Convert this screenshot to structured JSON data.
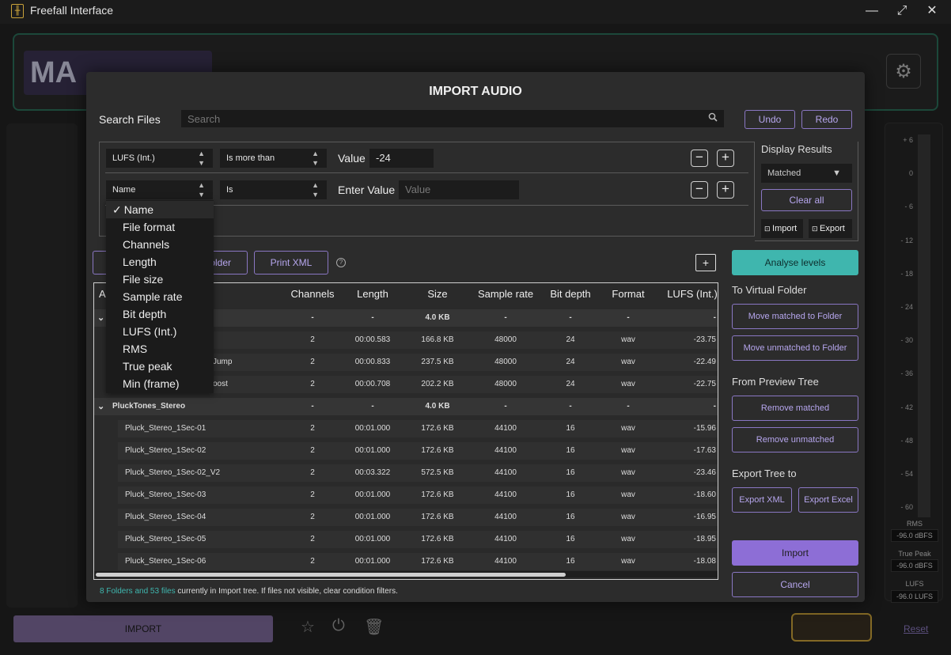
{
  "window": {
    "title": "Freefall Interface",
    "min": "—",
    "max": "⤢",
    "close": "✕"
  },
  "background": {
    "logo_text": "MA",
    "import_label": "IMPORT",
    "reset_label": "Reset",
    "meter": {
      "ticks": [
        "+ 6",
        "0",
        "- 6",
        "- 12",
        "- 18",
        "- 24",
        "- 30",
        "- 36",
        "- 42",
        "- 48",
        "- 54",
        "- 60"
      ],
      "rms_label": "RMS",
      "rms_value": "-96.0 dBFS",
      "peak_label": "True Peak",
      "peak_value": "-96.0 dBFS",
      "lufs_label": "LUFS",
      "lufs_value": "-96.0 LUFS"
    }
  },
  "modal": {
    "title": "IMPORT AUDIO",
    "search_label": "Search Files",
    "search_placeholder": "Search",
    "undo": "Undo",
    "redo": "Redo",
    "filters": [
      {
        "field": "LUFS (Int.)",
        "operator": "Is more than",
        "value_label": "Value",
        "value": "-24"
      },
      {
        "field": "Name",
        "operator": "Is",
        "value_label": "Enter Value",
        "value_placeholder": "Value"
      }
    ],
    "display_results": {
      "label": "Display Results",
      "selected": "Matched",
      "clear_all": "Clear all",
      "import": "Import",
      "export": "Export"
    },
    "toolbar": {
      "folder_btn": "older",
      "print_xml": "Print XML"
    },
    "dropdown": {
      "items": [
        "Name",
        "File format",
        "Channels",
        "Length",
        "File size",
        "Sample rate",
        "Bit depth",
        "LUFS (Int.)",
        "RMS",
        "True peak",
        "Min (frame)"
      ],
      "selected_mark": "✓"
    },
    "table": {
      "headers": {
        "name": "A",
        "channels": "Channels",
        "length": "Length",
        "size": "Size",
        "sample_rate": "Sample rate",
        "bit_depth": "Bit depth",
        "format": "Format",
        "lufs": "LUFS (Int.)"
      },
      "rows": [
        {
          "type": "folder",
          "name": "",
          "channels": "-",
          "length": "-",
          "size": "4.0 KB",
          "sample_rate": "-",
          "bit_depth": "-",
          "format": "-",
          "lufs": "-"
        },
        {
          "type": "file",
          "name": "",
          "channels": "2",
          "length": "00:00.583",
          "size": "166.8 KB",
          "sample_rate": "48000",
          "bit_depth": "24",
          "format": "wav",
          "lufs": "-23.75"
        },
        {
          "type": "file",
          "name": "Jump",
          "channels": "2",
          "length": "00:00.833",
          "size": "237.5 KB",
          "sample_rate": "48000",
          "bit_depth": "24",
          "format": "wav",
          "lufs": "-22.49"
        },
        {
          "type": "file",
          "name": "oost",
          "channels": "2",
          "length": "00:00.708",
          "size": "202.2 KB",
          "sample_rate": "48000",
          "bit_depth": "24",
          "format": "wav",
          "lufs": "-22.75"
        },
        {
          "type": "folder",
          "name": "PluckTones_Stereo",
          "channels": "-",
          "length": "-",
          "size": "4.0 KB",
          "sample_rate": "-",
          "bit_depth": "-",
          "format": "-",
          "lufs": "-"
        },
        {
          "type": "file",
          "name": "Pluck_Stereo_1Sec-01",
          "channels": "2",
          "length": "00:01.000",
          "size": "172.6 KB",
          "sample_rate": "44100",
          "bit_depth": "16",
          "format": "wav",
          "lufs": "-15.96"
        },
        {
          "type": "file",
          "name": "Pluck_Stereo_1Sec-02",
          "channels": "2",
          "length": "00:01.000",
          "size": "172.6 KB",
          "sample_rate": "44100",
          "bit_depth": "16",
          "format": "wav",
          "lufs": "-17.63"
        },
        {
          "type": "file",
          "name": "Pluck_Stereo_1Sec-02_V2",
          "channels": "2",
          "length": "00:03.322",
          "size": "572.5 KB",
          "sample_rate": "44100",
          "bit_depth": "16",
          "format": "wav",
          "lufs": "-23.46"
        },
        {
          "type": "file",
          "name": "Pluck_Stereo_1Sec-03",
          "channels": "2",
          "length": "00:01.000",
          "size": "172.6 KB",
          "sample_rate": "44100",
          "bit_depth": "16",
          "format": "wav",
          "lufs": "-18.60"
        },
        {
          "type": "file",
          "name": "Pluck_Stereo_1Sec-04",
          "channels": "2",
          "length": "00:01.000",
          "size": "172.6 KB",
          "sample_rate": "44100",
          "bit_depth": "16",
          "format": "wav",
          "lufs": "-16.95"
        },
        {
          "type": "file",
          "name": "Pluck_Stereo_1Sec-05",
          "channels": "2",
          "length": "00:01.000",
          "size": "172.6 KB",
          "sample_rate": "44100",
          "bit_depth": "16",
          "format": "wav",
          "lufs": "-18.95"
        },
        {
          "type": "file",
          "name": "Pluck_Stereo_1Sec-06",
          "channels": "2",
          "length": "00:01.000",
          "size": "172.6 KB",
          "sample_rate": "44100",
          "bit_depth": "16",
          "format": "wav",
          "lufs": "-18.08"
        }
      ]
    },
    "sidebar": {
      "analyse": "Analyse levels",
      "virtual_folder_title": "To Virtual Folder",
      "move_matched": "Move matched to Folder",
      "move_unmatched": "Move unmatched to Folder",
      "preview_tree_title": "From Preview Tree",
      "remove_matched": "Remove matched",
      "remove_unmatched": "Remove unmatched",
      "export_tree_title": "Export Tree to",
      "export_xml": "Export XML",
      "export_excel": "Export Excel",
      "import": "Import",
      "cancel": "Cancel"
    },
    "status": {
      "highlight": "8 Folders and 53 files",
      "rest": " currently in Import tree. If files not visible, clear condition filters."
    }
  }
}
